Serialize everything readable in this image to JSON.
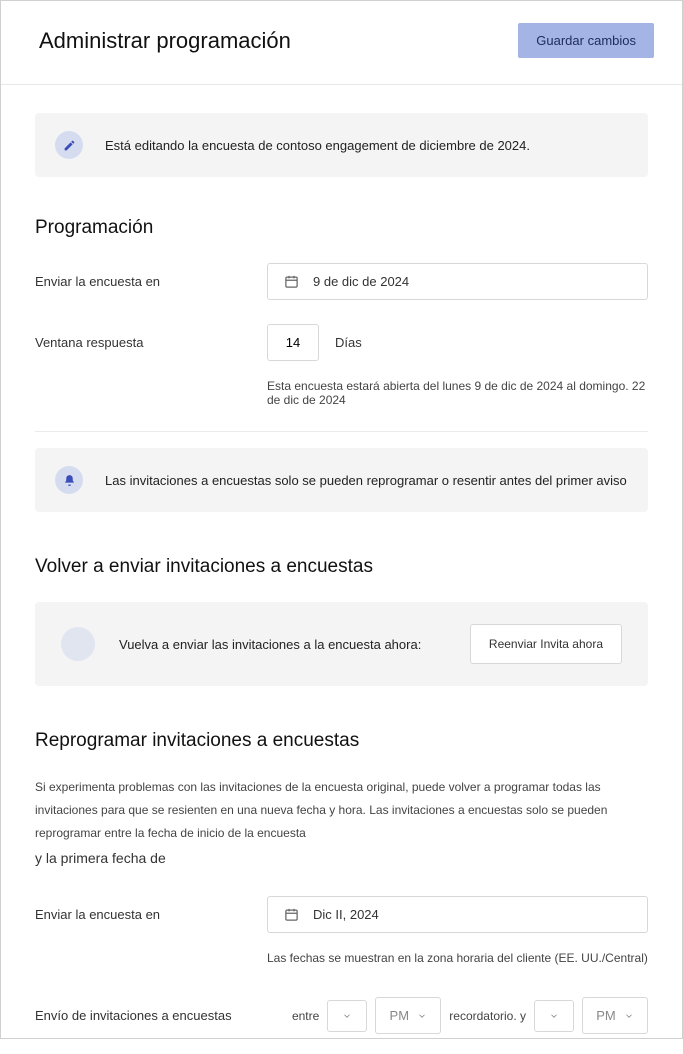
{
  "header": {
    "title": "Administrar programación",
    "save_label": "Guardar cambios"
  },
  "edit_banner": {
    "text": "Está editando la encuesta de contoso engagement de diciembre de 2024."
  },
  "schedule": {
    "title": "Programación",
    "send_label": "Enviar la encuesta en",
    "send_date": "9 de dic de 2024",
    "window_label": "Ventana respuesta",
    "window_value": "14",
    "window_unit": "Días",
    "window_helper": "Esta encuesta estará abierta del lunes 9 de dic de 2024 al domingo. 22 de dic de 2024"
  },
  "invite_banner": {
    "text": "Las invitaciones a encuestas solo se pueden reprogramar o resentir antes del primer aviso"
  },
  "resend": {
    "title": "Volver a enviar invitaciones a encuestas",
    "text": "Vuelva a enviar las invitaciones a la encuesta ahora:",
    "button_line1": "Reenviar",
    "button_line2": "Invita ahora"
  },
  "reschedule": {
    "title": "Reprogramar invitaciones a encuestas",
    "desc": "Si experimenta problemas con las invitaciones de la encuesta original, puede volver a programar todas las invitaciones para que se resienten en una nueva fecha y hora. Las invitaciones a encuestas solo se pueden reprogramar entre la fecha de inicio de la encuesta",
    "desc_last": "y la primera fecha de",
    "send_label": "Enviar la encuesta en",
    "send_date": "Dic II, 2024",
    "tz_helper": "Las fechas se muestran en la zona horaria del cliente (EE. UU./Central)",
    "time_label": "Envío de invitaciones a encuestas",
    "between": "entre",
    "pm1": "PM",
    "and": "recordatorio. y",
    "pm2": "PM"
  }
}
